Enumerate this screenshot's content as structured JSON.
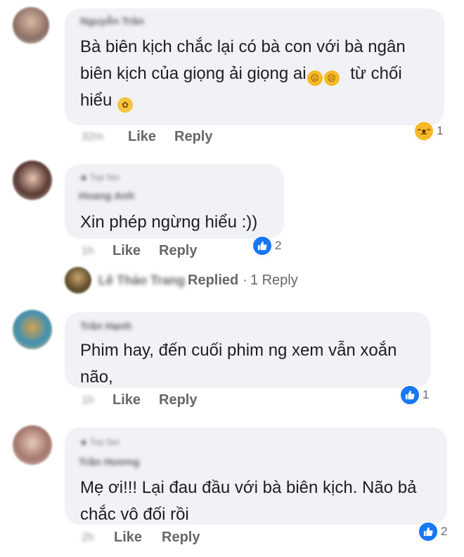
{
  "comments": [
    {
      "author": "Nguyễn Trần",
      "badge": "",
      "text_lines": [
        "Bà biên kịch chắc lại có bà con với bà ngân",
        "biên kịch của giọng ải giọng ai",
        "hiểu"
      ],
      "after_emoji_text": "từ chối",
      "emojis": [
        "weary-face-emoji",
        "weary-face-emoji",
        "sneezing-face-emoji"
      ],
      "time": "32m",
      "like_label": "Like",
      "reply_label": "Reply",
      "reaction": {
        "icon": "haha-reaction-icon",
        "count": "1"
      },
      "colors": {
        "reaction": "#f7b928"
      }
    },
    {
      "author": "Hoang Anh",
      "badge": "Top fan",
      "text_lines": [
        "Xin phép ngừng hiểu :))"
      ],
      "time": "1h",
      "like_label": "Like",
      "reply_label": "Reply",
      "reaction": {
        "icon": "like-reaction-icon",
        "count": "2"
      },
      "replied": {
        "name": "Lê Thảo Trang",
        "label": "Replied",
        "sep": "·",
        "count_label": "1 Reply"
      },
      "colors": {
        "reaction": "#1877f2"
      }
    },
    {
      "author": "Trần Hạnh",
      "badge": "",
      "text_lines": [
        "Phim hay, đến cuối phim ng xem vẫn xoắn",
        "não,"
      ],
      "time": "1h",
      "like_label": "Like",
      "reply_label": "Reply",
      "reaction": {
        "icon": "like-reaction-icon",
        "count": "1"
      },
      "colors": {
        "reaction": "#1877f2"
      }
    },
    {
      "author": "Trần Hương",
      "badge": "Top fan",
      "text_lines": [
        "Mẹ ơi!!! Lại đau đầu với bà biên kịch. Não bả",
        "chắc vô đối rồi"
      ],
      "time": "2h",
      "like_label": "Like",
      "reply_label": "Reply",
      "reaction": {
        "icon": "like-reaction-icon",
        "count": "2"
      },
      "colors": {
        "reaction": "#1877f2"
      }
    }
  ],
  "theme": {
    "bubble": "#f0f2f5",
    "meta": "#65676b",
    "text": "#1c1e21"
  }
}
